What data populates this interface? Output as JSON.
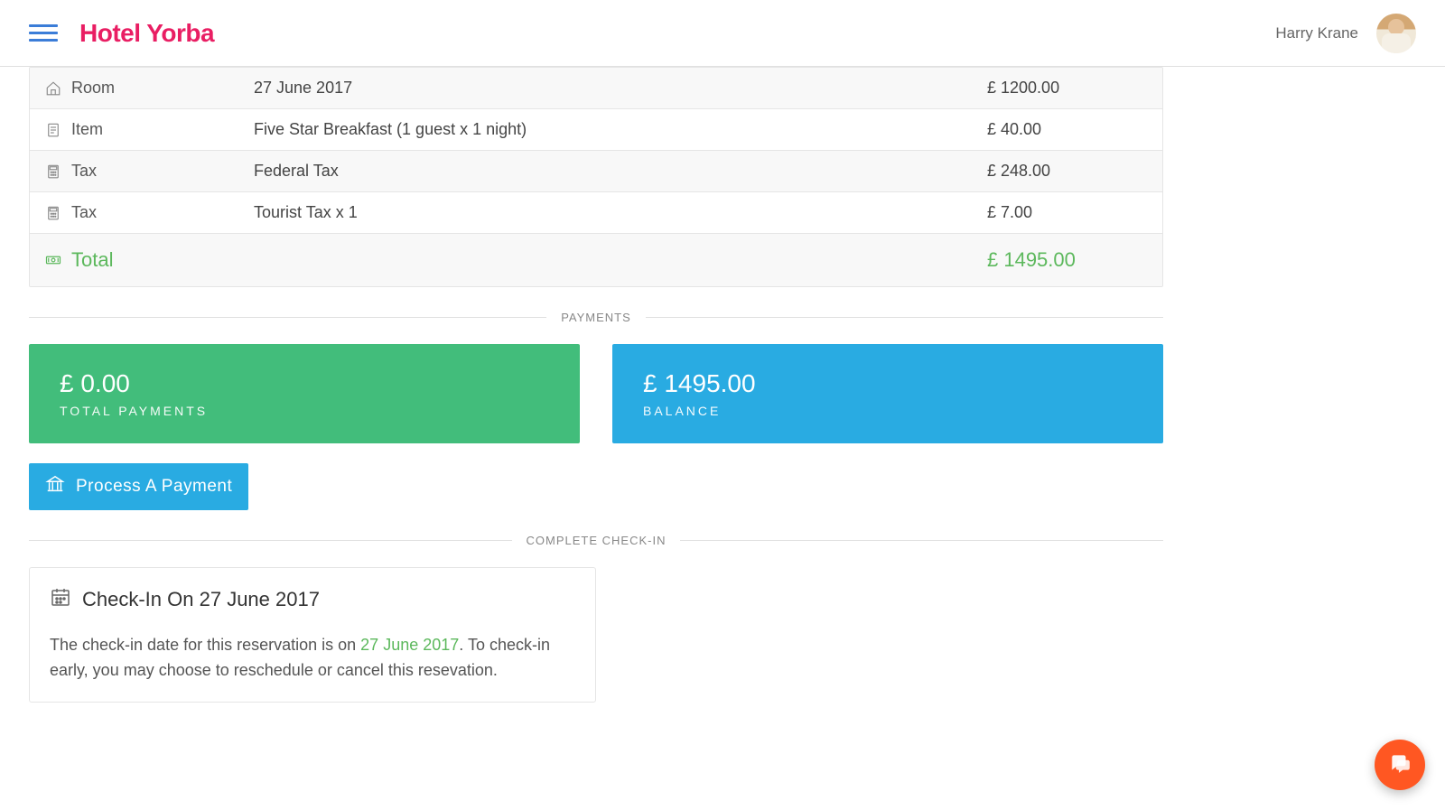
{
  "header": {
    "brand": "Hotel Yorba",
    "username": "Harry Krane"
  },
  "invoice": {
    "rows": [
      {
        "category": "Room",
        "description": "27 June 2017",
        "amount": "£ 1200.00",
        "icon": "home"
      },
      {
        "category": "Item",
        "description": "Five Star Breakfast (1 guest x 1 night)",
        "amount": "£ 40.00",
        "icon": "doc"
      },
      {
        "category": "Tax",
        "description": "Federal Tax",
        "amount": "£ 248.00",
        "icon": "calc"
      },
      {
        "category": "Tax",
        "description": "Tourist Tax x 1",
        "amount": "£ 7.00",
        "icon": "calc"
      }
    ],
    "total_label": "Total",
    "total_amount": "£ 1495.00"
  },
  "sections": {
    "payments_heading": "PAYMENTS",
    "checkin_heading": "COMPLETE CHECK-IN"
  },
  "payments": {
    "total_payments_value": "£ 0.00",
    "total_payments_label": "TOTAL PAYMENTS",
    "balance_value": "£ 1495.00",
    "balance_label": "BALANCE",
    "process_button": "Process A Payment"
  },
  "checkin": {
    "title": "Check-In On 27 June 2017",
    "body_pre": "The check-in date for this reservation is on ",
    "body_date": "27 June 2017",
    "body_post": ". To check-in early, you may choose to reschedule or cancel this resevation."
  }
}
